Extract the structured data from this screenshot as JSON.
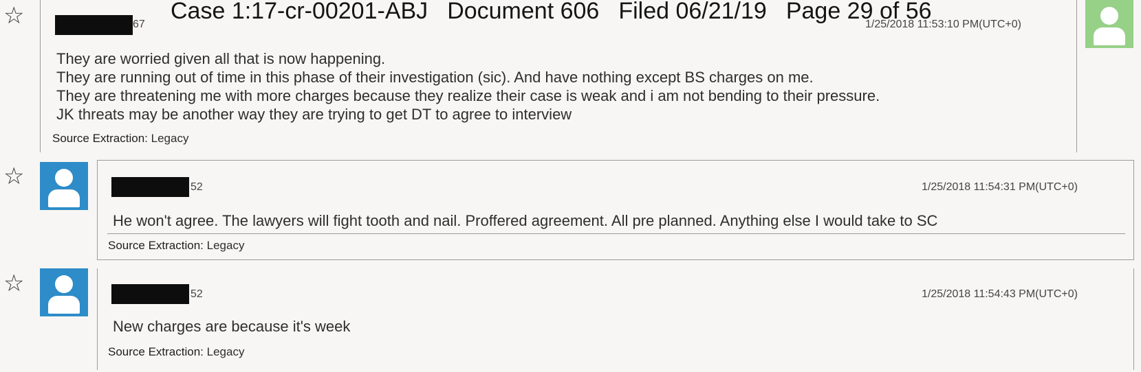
{
  "header": {
    "case": "Case 1:17-cr-00201-ABJ",
    "document": "Document 606",
    "filed": "Filed 06/21/19",
    "page": "Page 29 of 56"
  },
  "messages": [
    {
      "sender_suffix": "67",
      "timestamp": "1/25/2018 11:53:10 PM(UTC+0)",
      "lines": [
        "They are worried given all that is now happening.",
        "They are running out of time in this phase of their investigation (sic). And have nothing except BS charges on me.",
        "They are threatening me with more charges because they realize their case is weak and i am not bending to their pressure.",
        "JK threats may be another way they are trying to get DT to agree to interview"
      ],
      "source_label": "Source Extraction:",
      "source_value": "Legacy",
      "avatar_color": "#97d087"
    },
    {
      "sender_suffix": "52",
      "timestamp": "1/25/2018 11:54:31 PM(UTC+0)",
      "lines": [
        "He won't agree. The lawyers will fight tooth and nail. Proffered agreement. All pre planned. Anything else I would take to SC"
      ],
      "source_label": "Source Extraction:",
      "source_value": "Legacy",
      "avatar_color": "#2e8cc8"
    },
    {
      "sender_suffix": "52",
      "timestamp": "1/25/2018 11:54:43 PM(UTC+0)",
      "lines": [
        "New charges are because it's week"
      ],
      "source_label": "Source Extraction:",
      "source_value": "Legacy",
      "avatar_color": "#2e8cc8"
    }
  ],
  "icons": {
    "star": "star-outline-icon",
    "avatar": "person-avatar-icon"
  }
}
